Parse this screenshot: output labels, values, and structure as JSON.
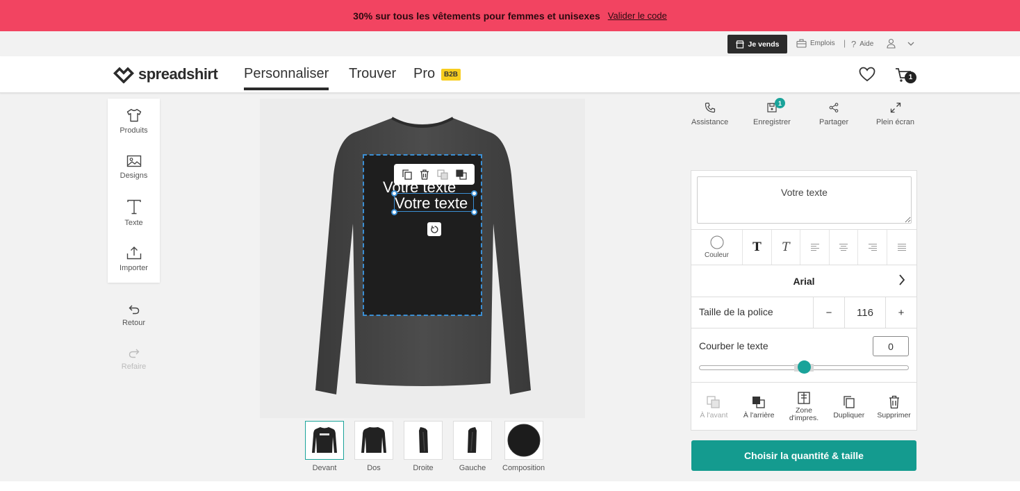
{
  "promo": {
    "message": "30% sur tous les vêtements pour femmes et unisexes",
    "link": "Valider le code",
    "bg": "#f24461"
  },
  "utility": {
    "sell": "Je vends",
    "jobs": "Emplois",
    "help": "Aide",
    "sep": "|"
  },
  "nav": {
    "brand": "spreadshirt",
    "tabs": [
      "Personnaliser",
      "Trouver",
      "Pro"
    ],
    "pro_badge": "B2B",
    "cart_count": "1"
  },
  "tools": [
    {
      "label": "Produits",
      "icon": "tshirt-icon"
    },
    {
      "label": "Designs",
      "icon": "image-icon"
    },
    {
      "label": "Texte",
      "icon": "text-icon"
    },
    {
      "label": "Importer",
      "icon": "upload-icon"
    }
  ],
  "history": {
    "undo": "Retour",
    "redo": "Refaire"
  },
  "canvas": {
    "text_a": "Votre texte",
    "text_b": "Votre texte"
  },
  "views": [
    {
      "label": "Devant"
    },
    {
      "label": "Dos"
    },
    {
      "label": "Droite"
    },
    {
      "label": "Gauche"
    },
    {
      "label": "Composition"
    }
  ],
  "actions": {
    "support": "Assistance",
    "save": "Enregistrer",
    "save_badge": "1",
    "share": "Partager",
    "fullscreen": "Plein écran"
  },
  "editor": {
    "text_value": "Votre texte",
    "color_label": "Couleur",
    "font": "Arial",
    "size_label": "Taille de la police",
    "size_minus": "−",
    "size_value": "116",
    "size_plus": "+",
    "curve_label": "Courber le texte",
    "curve_value": "0",
    "curve_position": 0.5,
    "layers": [
      {
        "label": "À l'avant",
        "disabled": true
      },
      {
        "label": "À l'arrière",
        "disabled": false
      },
      {
        "label": "Zone d'impres.",
        "disabled": false
      },
      {
        "label": "Dupliquer",
        "disabled": false
      },
      {
        "label": "Supprimer",
        "disabled": false
      }
    ]
  },
  "cta": "Choisir la quantité & taille",
  "colors": {
    "accent": "#149b8f",
    "dark": "#2b2b2b",
    "selection": "#3b8fd4"
  }
}
